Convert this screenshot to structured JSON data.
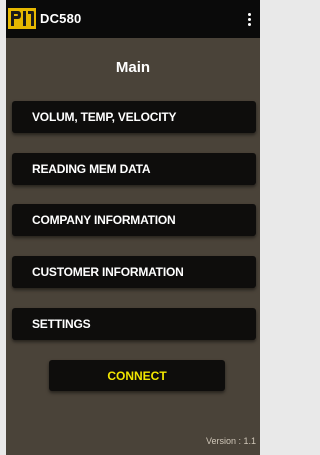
{
  "app": {
    "logo_text": "PI",
    "title": "DC580",
    "menu_icon": "more-vert-icon",
    "brand_color": "#e6b800"
  },
  "screen": {
    "title": "Main"
  },
  "menu": {
    "items": [
      {
        "label": "VOLUM, TEMP, VELOCITY"
      },
      {
        "label": "READING MEM DATA"
      },
      {
        "label": "COMPANY INFORMATION"
      },
      {
        "label": "CUSTOMER INFORMATION"
      },
      {
        "label": "SETTINGS"
      }
    ]
  },
  "connect": {
    "label": "CONNECT",
    "color": "#f2e600"
  },
  "footer": {
    "version": "Version : 1.1"
  }
}
